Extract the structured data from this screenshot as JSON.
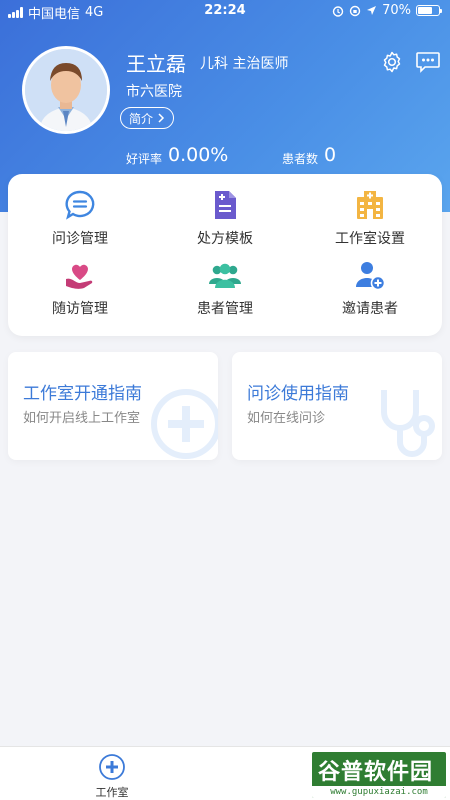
{
  "status_bar": {
    "carrier": "中国电信",
    "network": "4G",
    "time": "22:24",
    "battery": "70%"
  },
  "profile": {
    "name": "王立磊",
    "title": "儿科  主治医师",
    "hospital": "市六医院",
    "intro_label": "简介"
  },
  "stats": {
    "rating_label": "好评率",
    "rating_value": "0.00%",
    "patients_label": "患者数",
    "patients_value": "0"
  },
  "menu": {
    "items": [
      {
        "label": "问诊管理",
        "icon": "chat-bubble-icon"
      },
      {
        "label": "处方模板",
        "icon": "prescription-icon"
      },
      {
        "label": "工作室设置",
        "icon": "hospital-building-icon"
      },
      {
        "label": "随访管理",
        "icon": "heart-hand-icon"
      },
      {
        "label": "患者管理",
        "icon": "patients-group-icon"
      },
      {
        "label": "邀请患者",
        "icon": "add-user-icon"
      }
    ]
  },
  "guides": [
    {
      "title": "工作室开通指南",
      "subtitle": "如何开启线上工作室",
      "icon": "medical-cross-icon"
    },
    {
      "title": "问诊使用指南",
      "subtitle": "如何在线问诊",
      "icon": "stethoscope-icon"
    }
  ],
  "tab_bar": {
    "active_label": "工作室"
  },
  "watermark": {
    "main": "谷普软件园",
    "url": "www.gupuxiazai.com"
  },
  "colors": {
    "header_start": "#3b6fd9",
    "header_end": "#5aa5ee",
    "accent_blue": "#3c7ad8",
    "background": "#f3f4f8"
  }
}
